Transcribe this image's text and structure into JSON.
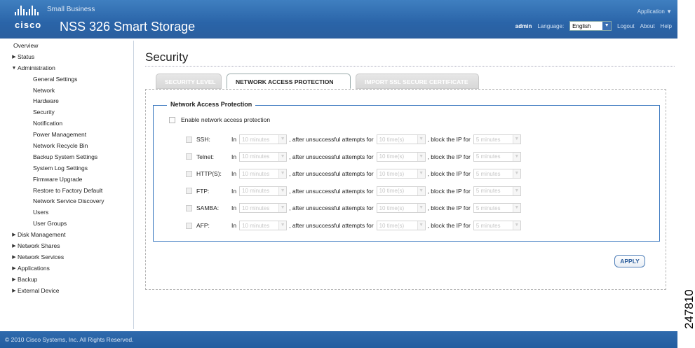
{
  "header": {
    "brand": "cisco",
    "small_business": "Small Business",
    "product": "NSS 326 Smart Storage",
    "application_menu": "Application ▼",
    "user": "admin",
    "language_label": "Language:",
    "language_value": "English",
    "logout": "Logout",
    "about": "About",
    "help": "Help"
  },
  "sidebar": {
    "top_before": [
      {
        "label": "Overview",
        "arrow": ""
      },
      {
        "label": "Status",
        "arrow": "▶"
      },
      {
        "label": "Administration",
        "arrow": "▼"
      }
    ],
    "admin_items": [
      "General Settings",
      "Network",
      "Hardware",
      "Security",
      "Notification",
      "Power Management",
      "Network Recycle Bin",
      "Backup System Settings",
      "System Log Settings",
      "Firmware Upgrade",
      "Restore to Factory Default",
      "Network Service Discovery",
      "Users",
      "User Groups"
    ],
    "top_after": [
      "Disk Management",
      "Network Shares",
      "Network Services",
      "Applications",
      "Backup",
      "External Device"
    ]
  },
  "main": {
    "title": "Security",
    "tabs": [
      {
        "label": "SECURITY LEVEL",
        "active": false
      },
      {
        "label": "NETWORK ACCESS PROTECTION",
        "active": true
      },
      {
        "label": "IMPORT SSL SECURE CERTIFICATE",
        "active": false
      }
    ],
    "legend": "Network Access Protection",
    "enable_label": "Enable network access protection",
    "row_in": "In",
    "row_after": ", after unsuccessful attempts for",
    "row_block": ", block the IP for",
    "services": [
      {
        "name": "SSH:",
        "interval": "10 minutes",
        "attempts": "10 time(s)",
        "block": "5 minutes"
      },
      {
        "name": "Telnet:",
        "interval": "10 minutes",
        "attempts": "10 time(s)",
        "block": "5 minutes"
      },
      {
        "name": "HTTP(S):",
        "interval": "10 minutes",
        "attempts": "10 time(s)",
        "block": "5 minutes"
      },
      {
        "name": "FTP:",
        "interval": "10 minutes",
        "attempts": "10 time(s)",
        "block": "5 minutes"
      },
      {
        "name": "SAMBA:",
        "interval": "10 minutes",
        "attempts": "10 time(s)",
        "block": "5 minutes"
      },
      {
        "name": "AFP:",
        "interval": "10 minutes",
        "attempts": "10 time(s)",
        "block": "5 minutes"
      }
    ],
    "apply": "APPLY"
  },
  "footer": {
    "copyright": "© 2010 Cisco Systems, Inc. All Rights Reserved."
  },
  "figure_id": "247810"
}
